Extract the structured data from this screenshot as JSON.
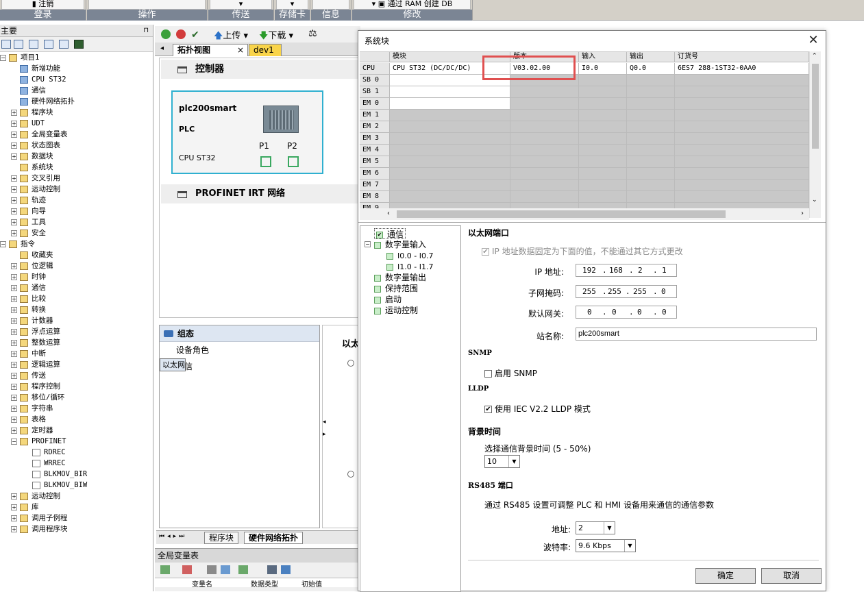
{
  "ribbon": {
    "groups": [
      {
        "button": "注销",
        "label": "登录"
      },
      {
        "button": "",
        "label": "操作"
      },
      {
        "button": "",
        "label": "传送"
      },
      {
        "button": "",
        "label": "存储卡"
      },
      {
        "button": "",
        "label": "信息"
      },
      {
        "button": "通过 RAM 创建 DB",
        "label": "修改"
      }
    ]
  },
  "left_panel": {
    "title": "主要",
    "pin": "⊓",
    "tree": [
      {
        "label": "项目1",
        "level": 0,
        "exp": "−"
      },
      {
        "label": "新增功能",
        "level": 1
      },
      {
        "label": "CPU ST32",
        "level": 1
      },
      {
        "label": "通信",
        "level": 1
      },
      {
        "label": "硬件网络拓扑",
        "level": 1
      },
      {
        "label": "程序块",
        "level": 1,
        "exp": "+"
      },
      {
        "label": "UDT",
        "level": 1,
        "exp": "+"
      },
      {
        "label": "全局变量表",
        "level": 1,
        "exp": "+"
      },
      {
        "label": "状态图表",
        "level": 1,
        "exp": "+"
      },
      {
        "label": "数据块",
        "level": 1,
        "exp": "+"
      },
      {
        "label": "系统块",
        "level": 1
      },
      {
        "label": "交叉引用",
        "level": 1,
        "exp": "+"
      },
      {
        "label": "运动控制",
        "level": 1,
        "exp": "+"
      },
      {
        "label": "轨迹",
        "level": 1,
        "exp": "+"
      },
      {
        "label": "向导",
        "level": 1,
        "exp": "+"
      },
      {
        "label": "工具",
        "level": 1,
        "exp": "+"
      },
      {
        "label": "安全",
        "level": 1,
        "exp": "+"
      },
      {
        "label": "指令",
        "level": 0,
        "exp": "−"
      },
      {
        "label": "收藏夹",
        "level": 1
      },
      {
        "label": "位逻辑",
        "level": 1,
        "exp": "+"
      },
      {
        "label": "时钟",
        "level": 1,
        "exp": "+"
      },
      {
        "label": "通信",
        "level": 1,
        "exp": "+"
      },
      {
        "label": "比较",
        "level": 1,
        "exp": "+"
      },
      {
        "label": "转换",
        "level": 1,
        "exp": "+"
      },
      {
        "label": "计数器",
        "level": 1,
        "exp": "+"
      },
      {
        "label": "浮点运算",
        "level": 1,
        "exp": "+"
      },
      {
        "label": "整数运算",
        "level": 1,
        "exp": "+"
      },
      {
        "label": "中断",
        "level": 1,
        "exp": "+"
      },
      {
        "label": "逻辑运算",
        "level": 1,
        "exp": "+"
      },
      {
        "label": "传送",
        "level": 1,
        "exp": "+"
      },
      {
        "label": "程序控制",
        "level": 1,
        "exp": "+"
      },
      {
        "label": "移位/循环",
        "level": 1,
        "exp": "+"
      },
      {
        "label": "字符串",
        "level": 1,
        "exp": "+"
      },
      {
        "label": "表格",
        "level": 1,
        "exp": "+"
      },
      {
        "label": "定时器",
        "level": 1,
        "exp": "+"
      },
      {
        "label": "PROFINET",
        "level": 1,
        "exp": "−"
      },
      {
        "label": "RDREC",
        "level": 2
      },
      {
        "label": "WRREC",
        "level": 2
      },
      {
        "label": "BLKMOV_BIR",
        "level": 2
      },
      {
        "label": "BLKMOV_BIW",
        "level": 2
      },
      {
        "label": "运动控制",
        "level": 1,
        "exp": "+"
      },
      {
        "label": "库",
        "level": 1,
        "exp": "+"
      },
      {
        "label": "调用子例程",
        "level": 1,
        "exp": "+"
      },
      {
        "label": "调用程序块",
        "level": 1,
        "exp": "+"
      }
    ]
  },
  "center": {
    "toolbar": {
      "upload": "上传",
      "download": "下载"
    },
    "tabs": [
      {
        "label": "拓扑视图",
        "close": "×"
      },
      {
        "label": "dev1"
      }
    ],
    "controller_heading": "控制器",
    "plc": {
      "name": "plc200smart",
      "type": "PLC",
      "cpu": "CPU ST32",
      "p1": "P1",
      "p2": "P2"
    },
    "network_heading": "PROFINET IRT 网络",
    "config": {
      "heading": "组态",
      "items": [
        "设备角色",
        "以太网",
        "通信"
      ],
      "selected": 1
    },
    "right_strip_label": "以太",
    "sheet_tabs": [
      "程序块",
      "硬件网络拓扑"
    ],
    "var_panel_title": "全局变量表",
    "var_columns": [
      "变量名",
      "数据类型",
      "初始值"
    ]
  },
  "dialog": {
    "title": "系统块",
    "close": "✕",
    "grid": {
      "columns": [
        "",
        "模块",
        "版本",
        "输入",
        "输出",
        "订货号"
      ],
      "rows": [
        [
          "CPU",
          "CPU ST32 (DC/DC/DC)",
          "V03.02.00",
          "I0.0",
          "Q0.0",
          "6ES7 288-1ST32-0AA0"
        ],
        [
          "SB 0",
          "",
          "",
          "",
          "",
          ""
        ],
        [
          "SB 1",
          "",
          "",
          "",
          "",
          ""
        ],
        [
          "EM 0",
          "",
          "",
          "",
          "",
          ""
        ],
        [
          "EM 1",
          "",
          "",
          "",
          "",
          ""
        ],
        [
          "EM 2",
          "",
          "",
          "",
          "",
          ""
        ],
        [
          "EM 3",
          "",
          "",
          "",
          "",
          ""
        ],
        [
          "EM 4",
          "",
          "",
          "",
          "",
          ""
        ],
        [
          "EM 5",
          "",
          "",
          "",
          "",
          ""
        ],
        [
          "EM 6",
          "",
          "",
          "",
          "",
          ""
        ],
        [
          "EM 7",
          "",
          "",
          "",
          "",
          ""
        ],
        [
          "EM 8",
          "",
          "",
          "",
          "",
          ""
        ],
        [
          "EM 9",
          "",
          "",
          "",
          "",
          ""
        ]
      ]
    },
    "nav_tree": [
      {
        "label": "通信",
        "level": 0,
        "selected": true
      },
      {
        "label": "数字量输入",
        "level": 0,
        "exp": "−"
      },
      {
        "label": "I0.0 - I0.7",
        "level": 1
      },
      {
        "label": "I1.0 - I1.7",
        "level": 1
      },
      {
        "label": "数字量输出",
        "level": 0
      },
      {
        "label": "保持范围",
        "level": 0
      },
      {
        "label": "启动",
        "level": 0
      },
      {
        "label": "运动控制",
        "level": 0
      }
    ],
    "ethernet": {
      "heading": "以太网端口",
      "fixed_ip_text": "IP 地址数据固定为下面的值，不能通过其它方式更改",
      "ip_label": "IP 地址:",
      "ip": [
        "192",
        "168",
        "2",
        "1"
      ],
      "mask_label": "子网掩码:",
      "mask": [
        "255",
        "255",
        "255",
        "0"
      ],
      "gateway_label": "默认网关:",
      "gateway": [
        "0",
        "0",
        "0",
        "0"
      ],
      "station_label": "站名称:",
      "station": "plc200smart"
    },
    "snmp": {
      "heading": "SNMP",
      "enable_label": "启用 SNMP"
    },
    "lldp": {
      "heading": "LLDP",
      "mode_label": "使用 IEC V2.2 LLDP 模式"
    },
    "background": {
      "heading": "背景时间",
      "select_label": "选择通信背景时间 (5 - 50%)",
      "value": "10"
    },
    "rs485": {
      "heading": "RS485 端口",
      "desc": "通过 RS485 设置可调整 PLC 和 HMI 设备用来通信的通信参数",
      "address_label": "地址:",
      "address": "2",
      "baud_label": "波特率:",
      "baud": "9.6 Kbps"
    },
    "buttons": {
      "ok": "确定",
      "cancel": "取消"
    }
  }
}
